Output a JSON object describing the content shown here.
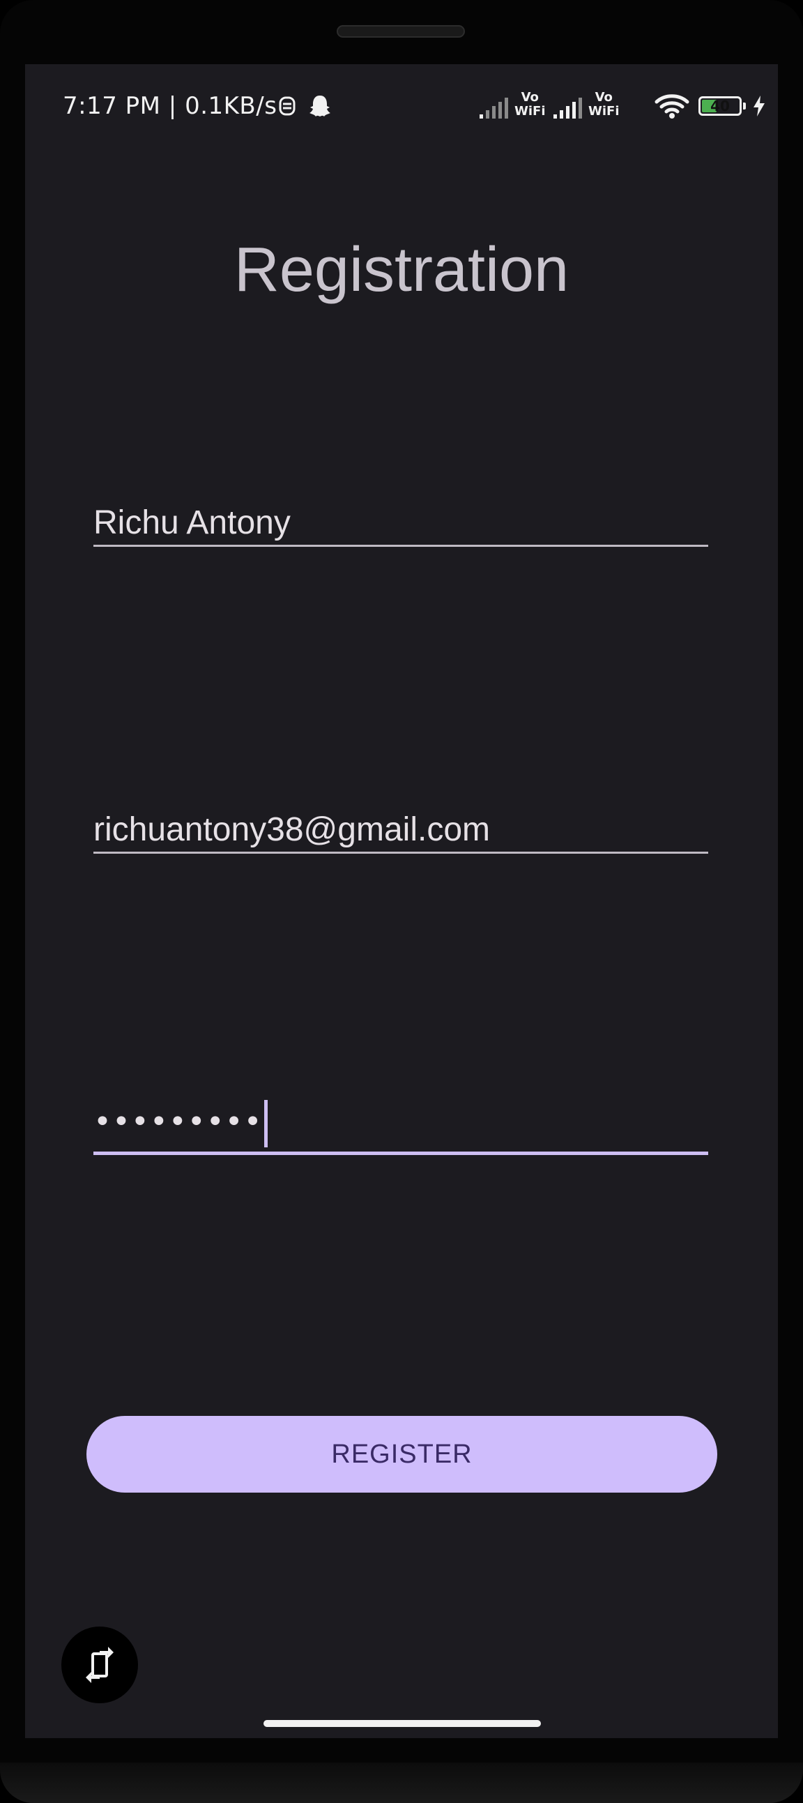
{
  "status_bar": {
    "time": "7:17 PM | 0.1KB/s",
    "vo_wifi_1_top": "Vo",
    "vo_wifi_1_bottom": "WiFi",
    "vo_wifi_2_top": "Vo",
    "vo_wifi_2_bottom": "WiFi",
    "battery_level": "40",
    "battery_percent": 40,
    "icons": [
      "notification-app-icon",
      "snapchat-ghost-icon",
      "signal-icon",
      "signal-icon",
      "wifi-icon",
      "battery-icon",
      "charging-bolt-icon"
    ]
  },
  "page": {
    "title": "Registration"
  },
  "form": {
    "name_value": "Richu Antony",
    "email_value": "richuantony38@gmail.com",
    "password_mask": "•••••••••"
  },
  "actions": {
    "register_label": "REGISTER",
    "rotate_icon": "screen-rotate-icon"
  },
  "colors": {
    "background": "#1c1b20",
    "accent": "#cfbdfc",
    "button_text": "#3a2a66",
    "battery": "#4caf50"
  }
}
